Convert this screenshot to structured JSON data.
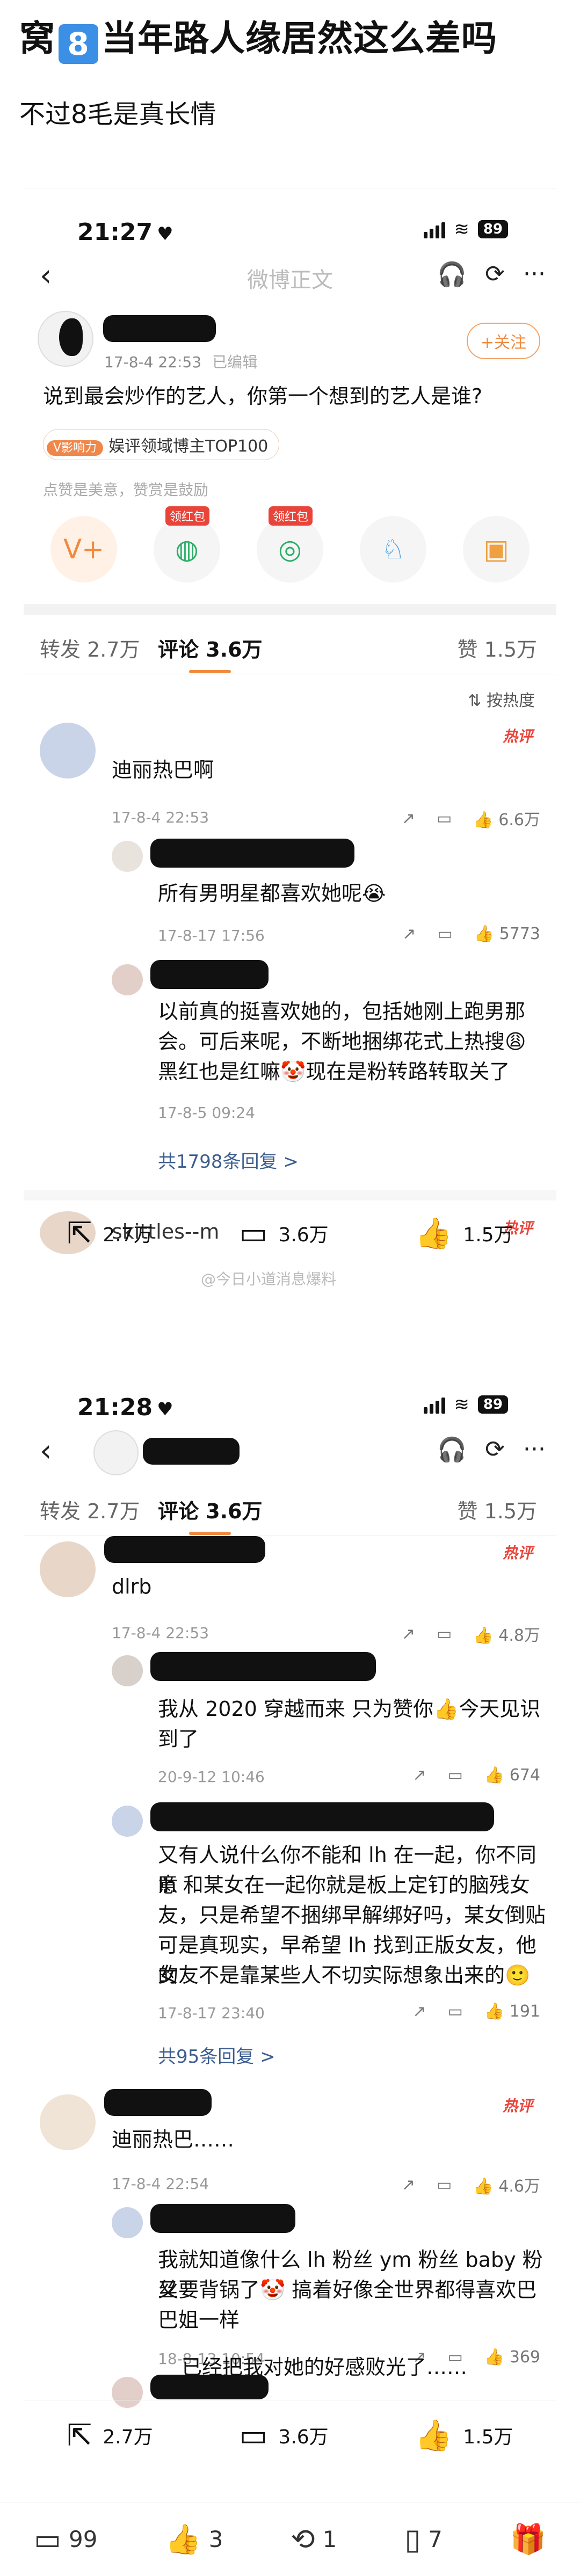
{
  "post": {
    "title_before": "窝",
    "title_badge": "8",
    "title_after": "当年路人缘居然这么差吗",
    "subtitle": "不过8毛是真长情"
  },
  "shot1": {
    "status_time": "21:27",
    "battery": "89",
    "nav_title": "微博正文",
    "author_time": "17-8-4 22:53",
    "author_edit": "已编辑",
    "follow": "+关注",
    "question": "说到最会炒作的艺人，你第一个想到的艺人是谁?",
    "tag_level": "V影响力",
    "tag_text": "娱评领域博主TOP100",
    "hint": "点赞是美意，赞赏是鼓励",
    "red_packet_1": "领红包",
    "red_packet_2": "领红包",
    "tabs": {
      "forward": "转发 2.7万",
      "comment": "评论 3.6万",
      "like": "赞 1.5万"
    },
    "sort": "按热度",
    "c1": {
      "hot": "热评",
      "text": "迪丽热巴啊",
      "time": "17-8-4 22:53",
      "likes": "6.6万"
    },
    "r1": {
      "text": "所有男明星都喜欢她呢😭",
      "time": "17-8-17 17:56",
      "likes": "5773"
    },
    "r2": {
      "text_1": "以前真的挺喜欢她的，包括她刚上跑男那",
      "text_2": "会。可后来呢，不断地捆绑花式上热搜😩",
      "text_3": "黑红也是红嘛🤡现在是粉转路转取关了",
      "time": "17-8-5 09:24"
    },
    "more": "共1798条回复 >",
    "c2_name": "skittles--m",
    "c2_hot": "热评",
    "bottom": {
      "forward": "2.7万",
      "comment": "3.6万",
      "like": "1.5万"
    },
    "watermark": "@今日小道消息爆料"
  },
  "shot2": {
    "status_time": "21:28",
    "battery": "89",
    "tabs": {
      "forward": "转发 2.7万",
      "comment": "评论 3.6万",
      "like": "赞 1.5万"
    },
    "c1": {
      "hot": "热评",
      "text": "dlrb",
      "time": "17-8-4 22:53",
      "likes": "4.8万"
    },
    "r1": {
      "text_1": "我从 2020 穿越而来 只为赞你👍今天见识",
      "text_2": "到了",
      "time": "20-9-12 10:46",
      "likes": "674"
    },
    "r2": {
      "text_1": "又有人说什么你不能和 lh 在一起，你不同意",
      "text_2": "lh 和某女在一起你就是板上定钉的脑残女",
      "text_3": "友，只是希望不捆绑早解绑好吗，某女倒贴",
      "text_4": "可是真现实，早希望 lh 找到正版女友，他的",
      "text_5": "女友不是靠某些人不切实际想象出来的🙂",
      "time": "17-8-17 23:40",
      "likes": "191"
    },
    "more1": "共95条回复 >",
    "c2": {
      "hot": "热评",
      "text": "迪丽热巴……",
      "time": "17-8-4 22:54",
      "likes": "4.6万"
    },
    "r3": {
      "text_1": "我就知道像什么 lh 粉丝 ym 粉丝 baby 粉丝",
      "text_2": "又要背锅了🤡 搞着好像全世界都得喜欢巴",
      "text_3": "巴姐一样",
      "time": "18-8-13 10:54",
      "likes": "369"
    },
    "r4": {
      "text": "已经把我对她的好感败光了……"
    },
    "bottom": {
      "forward": "2.7万",
      "comment": "3.6万",
      "like": "1.5万"
    }
  },
  "footer": {
    "comments": "99",
    "likes": "3",
    "reposts": "1",
    "favorites": "7"
  }
}
